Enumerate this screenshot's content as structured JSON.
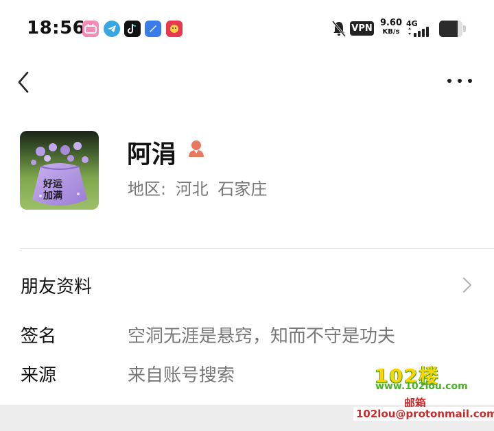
{
  "status_bar": {
    "time": "18:56",
    "vpn_label": "VPN",
    "net_speed_value": "9.60",
    "net_speed_unit": "KB/s",
    "network_type": "4G",
    "battery_level": 0.78,
    "app_icons": [
      "bilibili-icon",
      "telegram-icon",
      "tiktok-icon",
      "mail-app-icon",
      "game-app-icon"
    ]
  },
  "nav": {
    "back_icon": "chevron-left-icon",
    "more_icon": "more-dots-icon"
  },
  "profile": {
    "name": "阿涓",
    "gender_icon": "user-female-icon",
    "region_label": "地区:",
    "region_province": "河北",
    "region_city": "石家庄",
    "avatar_text_line1": "好运",
    "avatar_text_line2": "加满"
  },
  "menu": {
    "friend_info_label": "朋友资料"
  },
  "details": {
    "signature_label": "签名",
    "signature_value": "空洞无涯是悬窍，知而不守是功夫",
    "source_label": "来源",
    "source_value": "来自账号搜索"
  },
  "watermark": {
    "logo": "102楼",
    "url": "www.102lou.com",
    "mail_label": "邮箱",
    "email": "102lou@protonmail.com"
  },
  "colors": {
    "primary_text": "#111111",
    "secondary_text": "#777777",
    "gender_icon": "#e8785f",
    "divider": "#e6e6e6"
  }
}
